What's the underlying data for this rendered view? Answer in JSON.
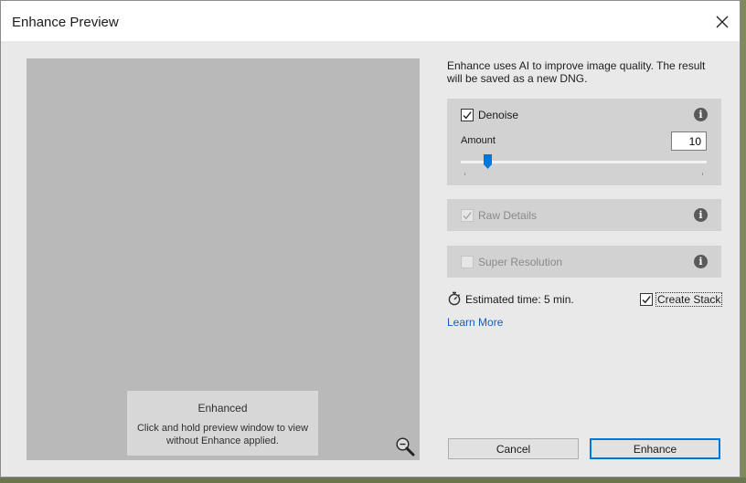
{
  "window": {
    "title": "Enhance Preview",
    "close_icon": "close-icon"
  },
  "preview": {
    "overlay_title": "Enhanced",
    "overlay_description": "Click and hold preview window to view without Enhance applied.",
    "zoom_icon": "zoom-out-icon"
  },
  "description": "Enhance uses AI to improve image quality. The result will be saved as a new DNG.",
  "options": {
    "denoise": {
      "label": "Denoise",
      "checked": true,
      "amount_label": "Amount",
      "amount_value": "10",
      "slider_fraction": 0.1
    },
    "raw_details": {
      "label": "Raw Details",
      "checked": true,
      "disabled": true
    },
    "super_resolution": {
      "label": "Super Resolution",
      "checked": false,
      "disabled": true
    }
  },
  "estimated_time": "Estimated time: 5 min.",
  "create_stack": {
    "label": "Create Stack",
    "checked": true
  },
  "learn_more": "Learn More",
  "buttons": {
    "cancel": "Cancel",
    "enhance": "Enhance"
  },
  "colors": {
    "accent": "#0078d7",
    "link": "#1660b8",
    "panel": "#d2d2d2",
    "preview": "#b9b9b9"
  }
}
